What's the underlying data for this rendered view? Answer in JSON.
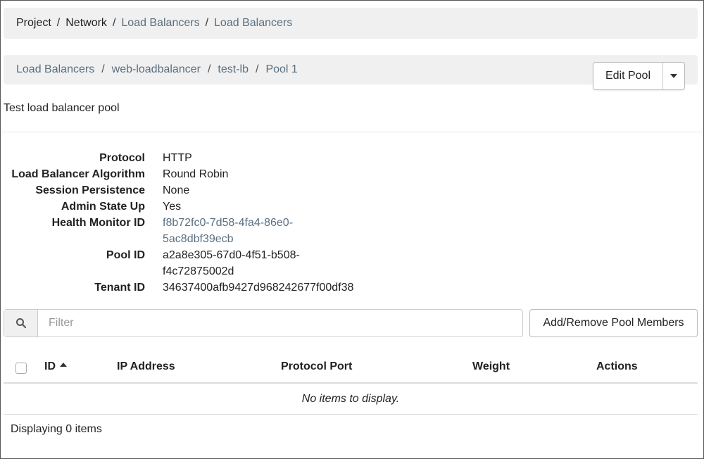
{
  "breadcrumb": {
    "items": [
      "Project",
      "Network",
      "Load Balancers",
      "Load Balancers"
    ]
  },
  "detail_breadcrumb": {
    "items": [
      "Load Balancers",
      "web-loadbalancer",
      "test-lb",
      "Pool 1"
    ]
  },
  "actions": {
    "edit_label": "Edit Pool"
  },
  "description": "Test load balancer pool",
  "properties": [
    {
      "label": "Protocol",
      "value": "HTTP"
    },
    {
      "label": "Load Balancer Algorithm",
      "value": "Round Robin"
    },
    {
      "label": "Session Persistence",
      "value": "None"
    },
    {
      "label": "Admin State Up",
      "value": "Yes"
    },
    {
      "label": "Health Monitor ID",
      "value_line1": "f8b72fc0-7d58-4fa4-86e0-",
      "value_line2": "5ac8dbf39ecb"
    },
    {
      "label": "Pool ID",
      "value_line1": "a2a8e305-67d0-4f51-b508-",
      "value_line2": "f4c72875002d"
    },
    {
      "label": "Tenant ID",
      "value": "34637400afb9427d968242677f00df38"
    }
  ],
  "filter": {
    "placeholder": "Filter"
  },
  "members_button_label": "Add/Remove Pool Members",
  "table": {
    "columns": [
      "ID",
      "IP Address",
      "Protocol Port",
      "Weight",
      "Actions"
    ],
    "empty_message": "No items to display."
  },
  "footer": {
    "count_text": "Displaying 0 items"
  },
  "colors": {
    "link": "#5a6f80",
    "bar_bg": "#f0f0f0"
  }
}
